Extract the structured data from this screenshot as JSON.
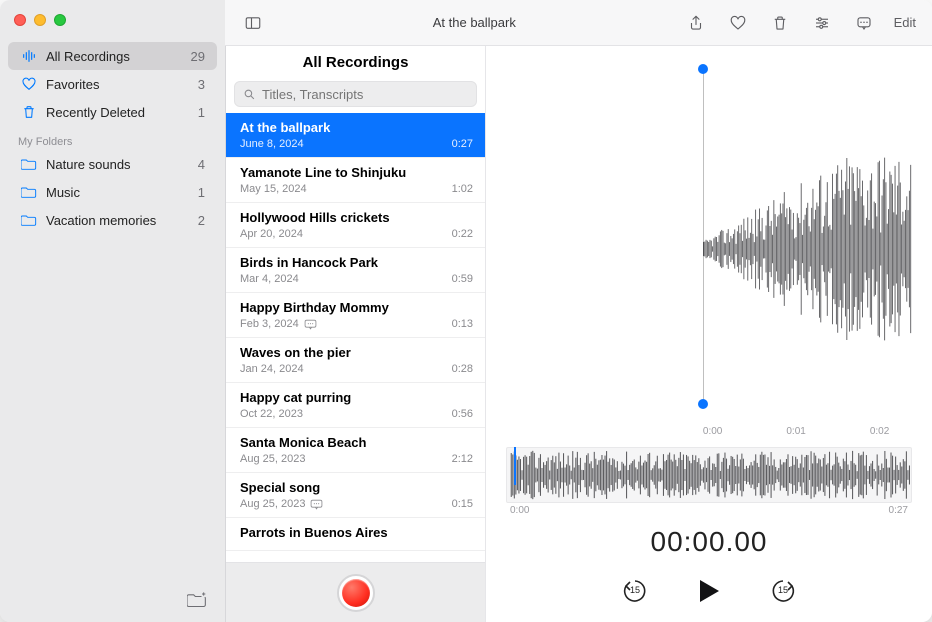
{
  "window": {
    "title": "At the ballpark",
    "edit_label": "Edit"
  },
  "sidebar": {
    "builtin": [
      {
        "icon": "waveform",
        "label": "All Recordings",
        "count": "29",
        "selected": true
      },
      {
        "icon": "heart",
        "label": "Favorites",
        "count": "3"
      },
      {
        "icon": "trash",
        "label": "Recently Deleted",
        "count": "1"
      }
    ],
    "folders_header": "My Folders",
    "folders": [
      {
        "label": "Nature sounds",
        "count": "4"
      },
      {
        "label": "Music",
        "count": "1"
      },
      {
        "label": "Vacation memories",
        "count": "2"
      }
    ]
  },
  "list": {
    "title": "All Recordings",
    "search_placeholder": "Titles, Transcripts",
    "recordings": [
      {
        "title": "At the ballpark",
        "date": "June 8, 2024",
        "duration": "0:27",
        "selected": true
      },
      {
        "title": "Yamanote Line to Shinjuku",
        "date": "May 15, 2024",
        "duration": "1:02"
      },
      {
        "title": "Hollywood Hills crickets",
        "date": "Apr 20, 2024",
        "duration": "0:22"
      },
      {
        "title": "Birds in Hancock Park",
        "date": "Mar 4, 2024",
        "duration": "0:59"
      },
      {
        "title": "Happy Birthday Mommy",
        "date": "Feb 3, 2024",
        "duration": "0:13",
        "has_transcript": true
      },
      {
        "title": "Waves on the pier",
        "date": "Jan 24, 2024",
        "duration": "0:28"
      },
      {
        "title": "Happy cat purring",
        "date": "Oct 22, 2023",
        "duration": "0:56"
      },
      {
        "title": "Santa Monica Beach",
        "date": "Aug 25, 2023",
        "duration": "2:12"
      },
      {
        "title": "Special song",
        "date": "Aug 25, 2023",
        "duration": "0:15",
        "has_transcript": true
      },
      {
        "title": "Parrots in Buenos Aires",
        "date": "",
        "duration": ""
      }
    ]
  },
  "detail": {
    "top_axis": [
      "0:00",
      "0:01",
      "0:02"
    ],
    "small_axis_start": "0:00",
    "small_axis_end": "0:27",
    "time_readout": "00:00.00",
    "skip_back_label": "15",
    "skip_fwd_label": "15"
  },
  "colors": {
    "accent": "#0a74ff",
    "record": "#ff2d20"
  }
}
